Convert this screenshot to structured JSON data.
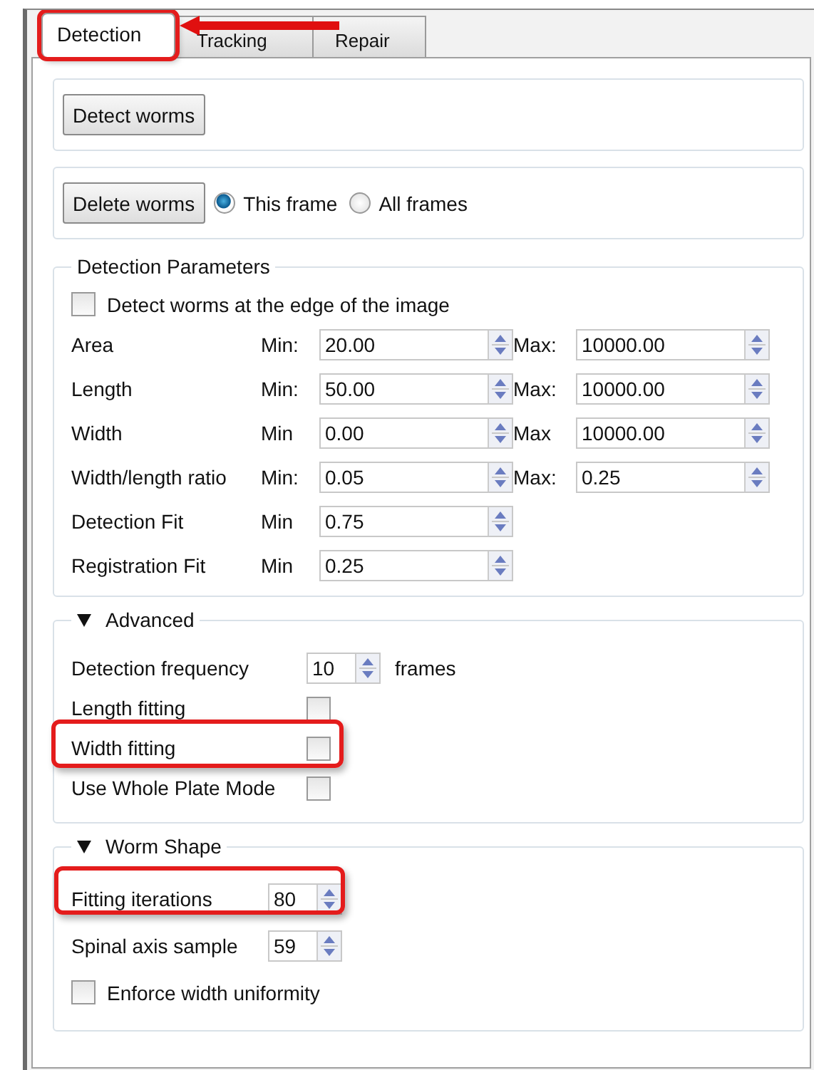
{
  "tabs": [
    {
      "label": "Detection",
      "selected": true,
      "highlighted": true
    },
    {
      "label": "Tracking",
      "selected": false,
      "highlighted": false
    },
    {
      "label": "Repair",
      "selected": false,
      "highlighted": false
    }
  ],
  "detect_group": {
    "button": "Detect worms"
  },
  "delete_group": {
    "button": "Delete worms",
    "options": [
      {
        "label": "This frame",
        "selected": true
      },
      {
        "label": "All frames",
        "selected": false
      }
    ]
  },
  "detection_parameters": {
    "title": "Detection Parameters",
    "edge_checkbox": {
      "label": "Detect worms at the edge of the image",
      "checked": false
    },
    "rows": [
      {
        "label": "Area",
        "min_label": "Min:",
        "min": "20.00",
        "max_label": "Max:",
        "max": "10000.00"
      },
      {
        "label": "Length",
        "min_label": "Min:",
        "min": "50.00",
        "max_label": "Max:",
        "max": "10000.00"
      },
      {
        "label": "Width",
        "min_label": "Min",
        "min": "0.00",
        "max_label": "Max",
        "max": "10000.00"
      },
      {
        "label": "Width/length ratio",
        "min_label": "Min:",
        "min": "0.05",
        "max_label": "Max:",
        "max": "0.25"
      },
      {
        "label": "Detection Fit",
        "min_label": "Min",
        "min": "0.75"
      },
      {
        "label": "Registration Fit",
        "min_label": "Min",
        "min": "0.25"
      }
    ]
  },
  "advanced": {
    "title": "Advanced",
    "expanded": true,
    "rows": [
      {
        "kind": "spin",
        "label": "Detection frequency",
        "value": "10",
        "unit": "frames",
        "highlighted": false
      },
      {
        "kind": "checkbox",
        "label": "Length fitting",
        "checked": false,
        "highlighted": false
      },
      {
        "kind": "checkbox",
        "label": "Width fitting",
        "checked": false,
        "highlighted": true
      },
      {
        "kind": "checkbox",
        "label": "Use Whole Plate Mode",
        "checked": false,
        "highlighted": false
      }
    ]
  },
  "worm_shape": {
    "title": "Worm Shape",
    "expanded": true,
    "rows": [
      {
        "kind": "spin",
        "label": "Fitting iterations",
        "value": "80",
        "highlighted": true
      },
      {
        "kind": "spin",
        "label": "Spinal axis sample",
        "value": "59",
        "highlighted": false
      },
      {
        "kind": "check_left",
        "label": "Enforce width uniformity",
        "checked": false,
        "highlighted": false
      }
    ]
  }
}
